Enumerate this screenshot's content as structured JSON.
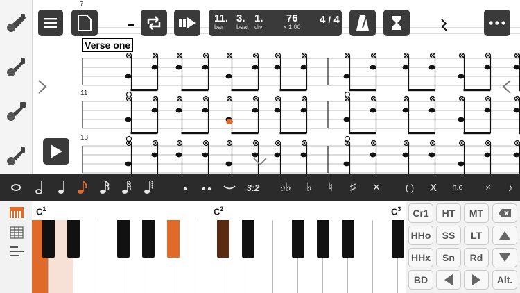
{
  "toolbar": {
    "position": {
      "bar": "11.",
      "bar_label": "bar",
      "beat": "3.",
      "beat_label": "beat",
      "div": "1.",
      "div_label": "div"
    },
    "tempo": {
      "value": "76",
      "factor": "x 1.00"
    },
    "time_signature": {
      "top": "4",
      "bottom": "4"
    }
  },
  "score": {
    "bar_numbers": [
      "7",
      "11",
      "13"
    ],
    "section_label": "Verse one"
  },
  "duration_bar": {
    "tuplet": "3:2",
    "paren": "( )",
    "cross": "X",
    "hammer": "h.o"
  },
  "keyboard": {
    "octave_labels": [
      {
        "note": "C",
        "octave": "1"
      },
      {
        "note": "C",
        "octave": "2"
      },
      {
        "note": "C",
        "octave": "3"
      }
    ],
    "colors": {
      "active": "#e06a2a",
      "light": "#f7e0d6",
      "dark": "#5a2a12"
    }
  },
  "drum_pad": {
    "buttons": [
      [
        "Cr1",
        "HT",
        "MT",
        "delete-icon"
      ],
      [
        "HHo",
        "SS",
        "LT",
        "up-icon"
      ],
      [
        "HHx",
        "Sn",
        "Rd",
        "down-icon"
      ],
      [
        "BD",
        "left-icon",
        "right-icon",
        "Alt."
      ]
    ],
    "labels": {
      "cr1": "Cr1",
      "ht": "HT",
      "mt": "MT",
      "hho": "HHo",
      "ss": "SS",
      "lt": "LT",
      "hhx": "HHx",
      "sn": "Sn",
      "rd": "Rd",
      "bd": "BD",
      "alt": "Alt."
    }
  },
  "accent_color": "#e06a2a"
}
